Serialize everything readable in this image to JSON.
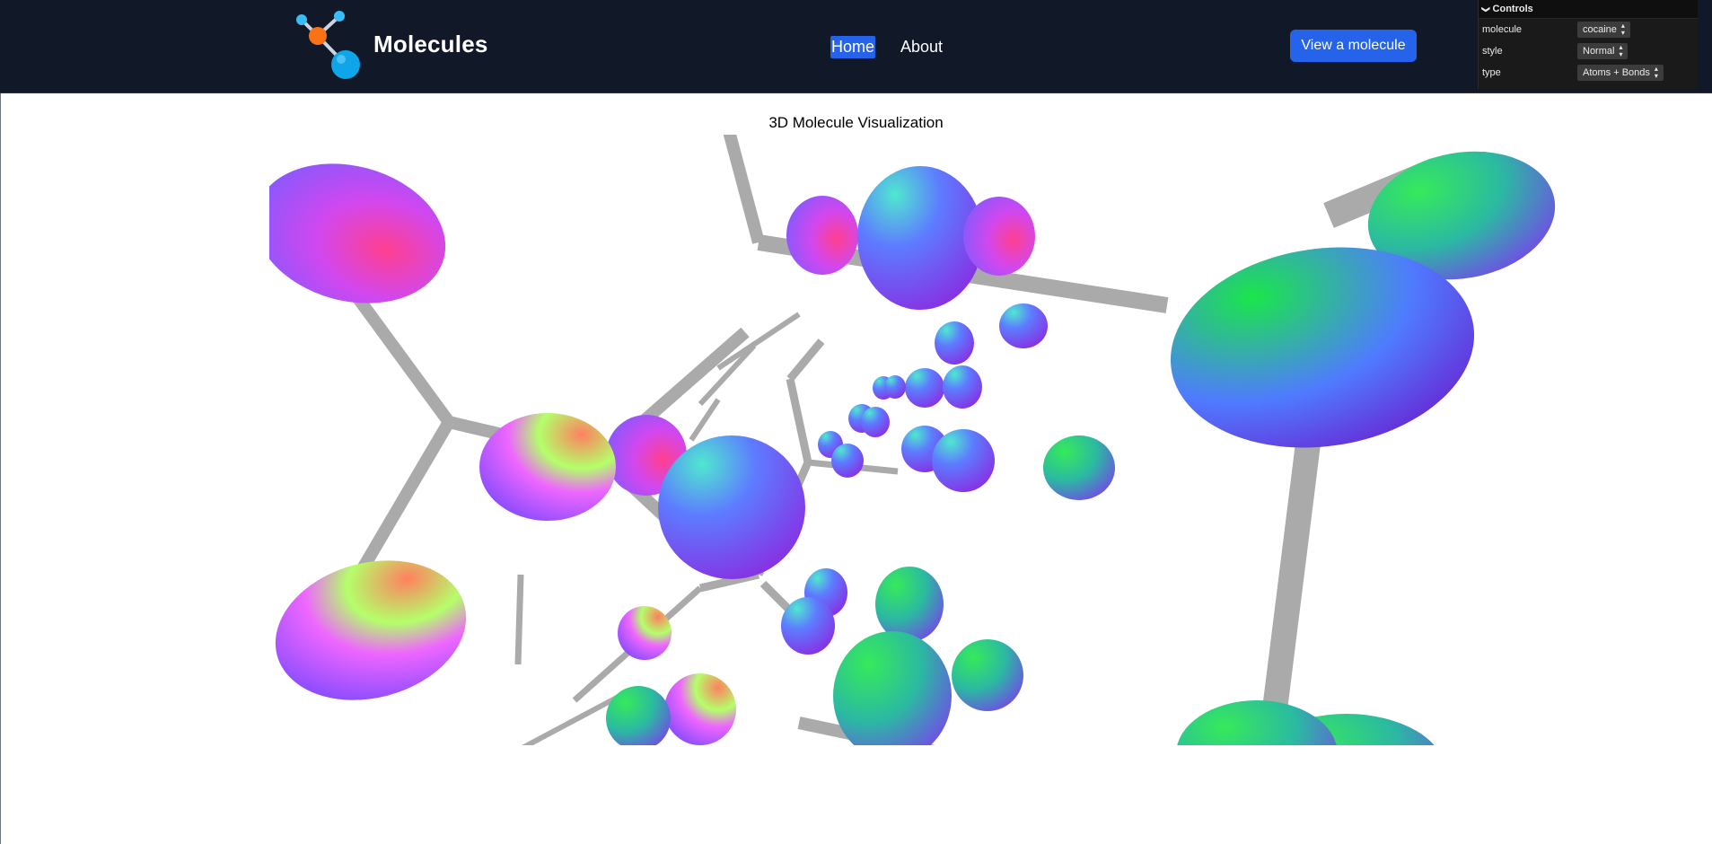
{
  "navbar": {
    "brand": "Molecules",
    "links": [
      {
        "label": "Home",
        "active": true
      },
      {
        "label": "About",
        "active": false
      }
    ],
    "cta_label": "View a molecule",
    "logo_icon": "molecule-logo-icon"
  },
  "controls": {
    "title": "Controls",
    "rows": [
      {
        "label": "molecule",
        "value": "cocaine"
      },
      {
        "label": "style",
        "value": "Normal"
      },
      {
        "label": "type",
        "value": "Atoms + Bonds"
      }
    ]
  },
  "main": {
    "title": "3D Molecule Visualization"
  },
  "colors": {
    "navbar_bg": "#111827",
    "accent": "#2563eb",
    "bond": "#aaaaaa",
    "panel_bg": "#1a1a1a"
  }
}
